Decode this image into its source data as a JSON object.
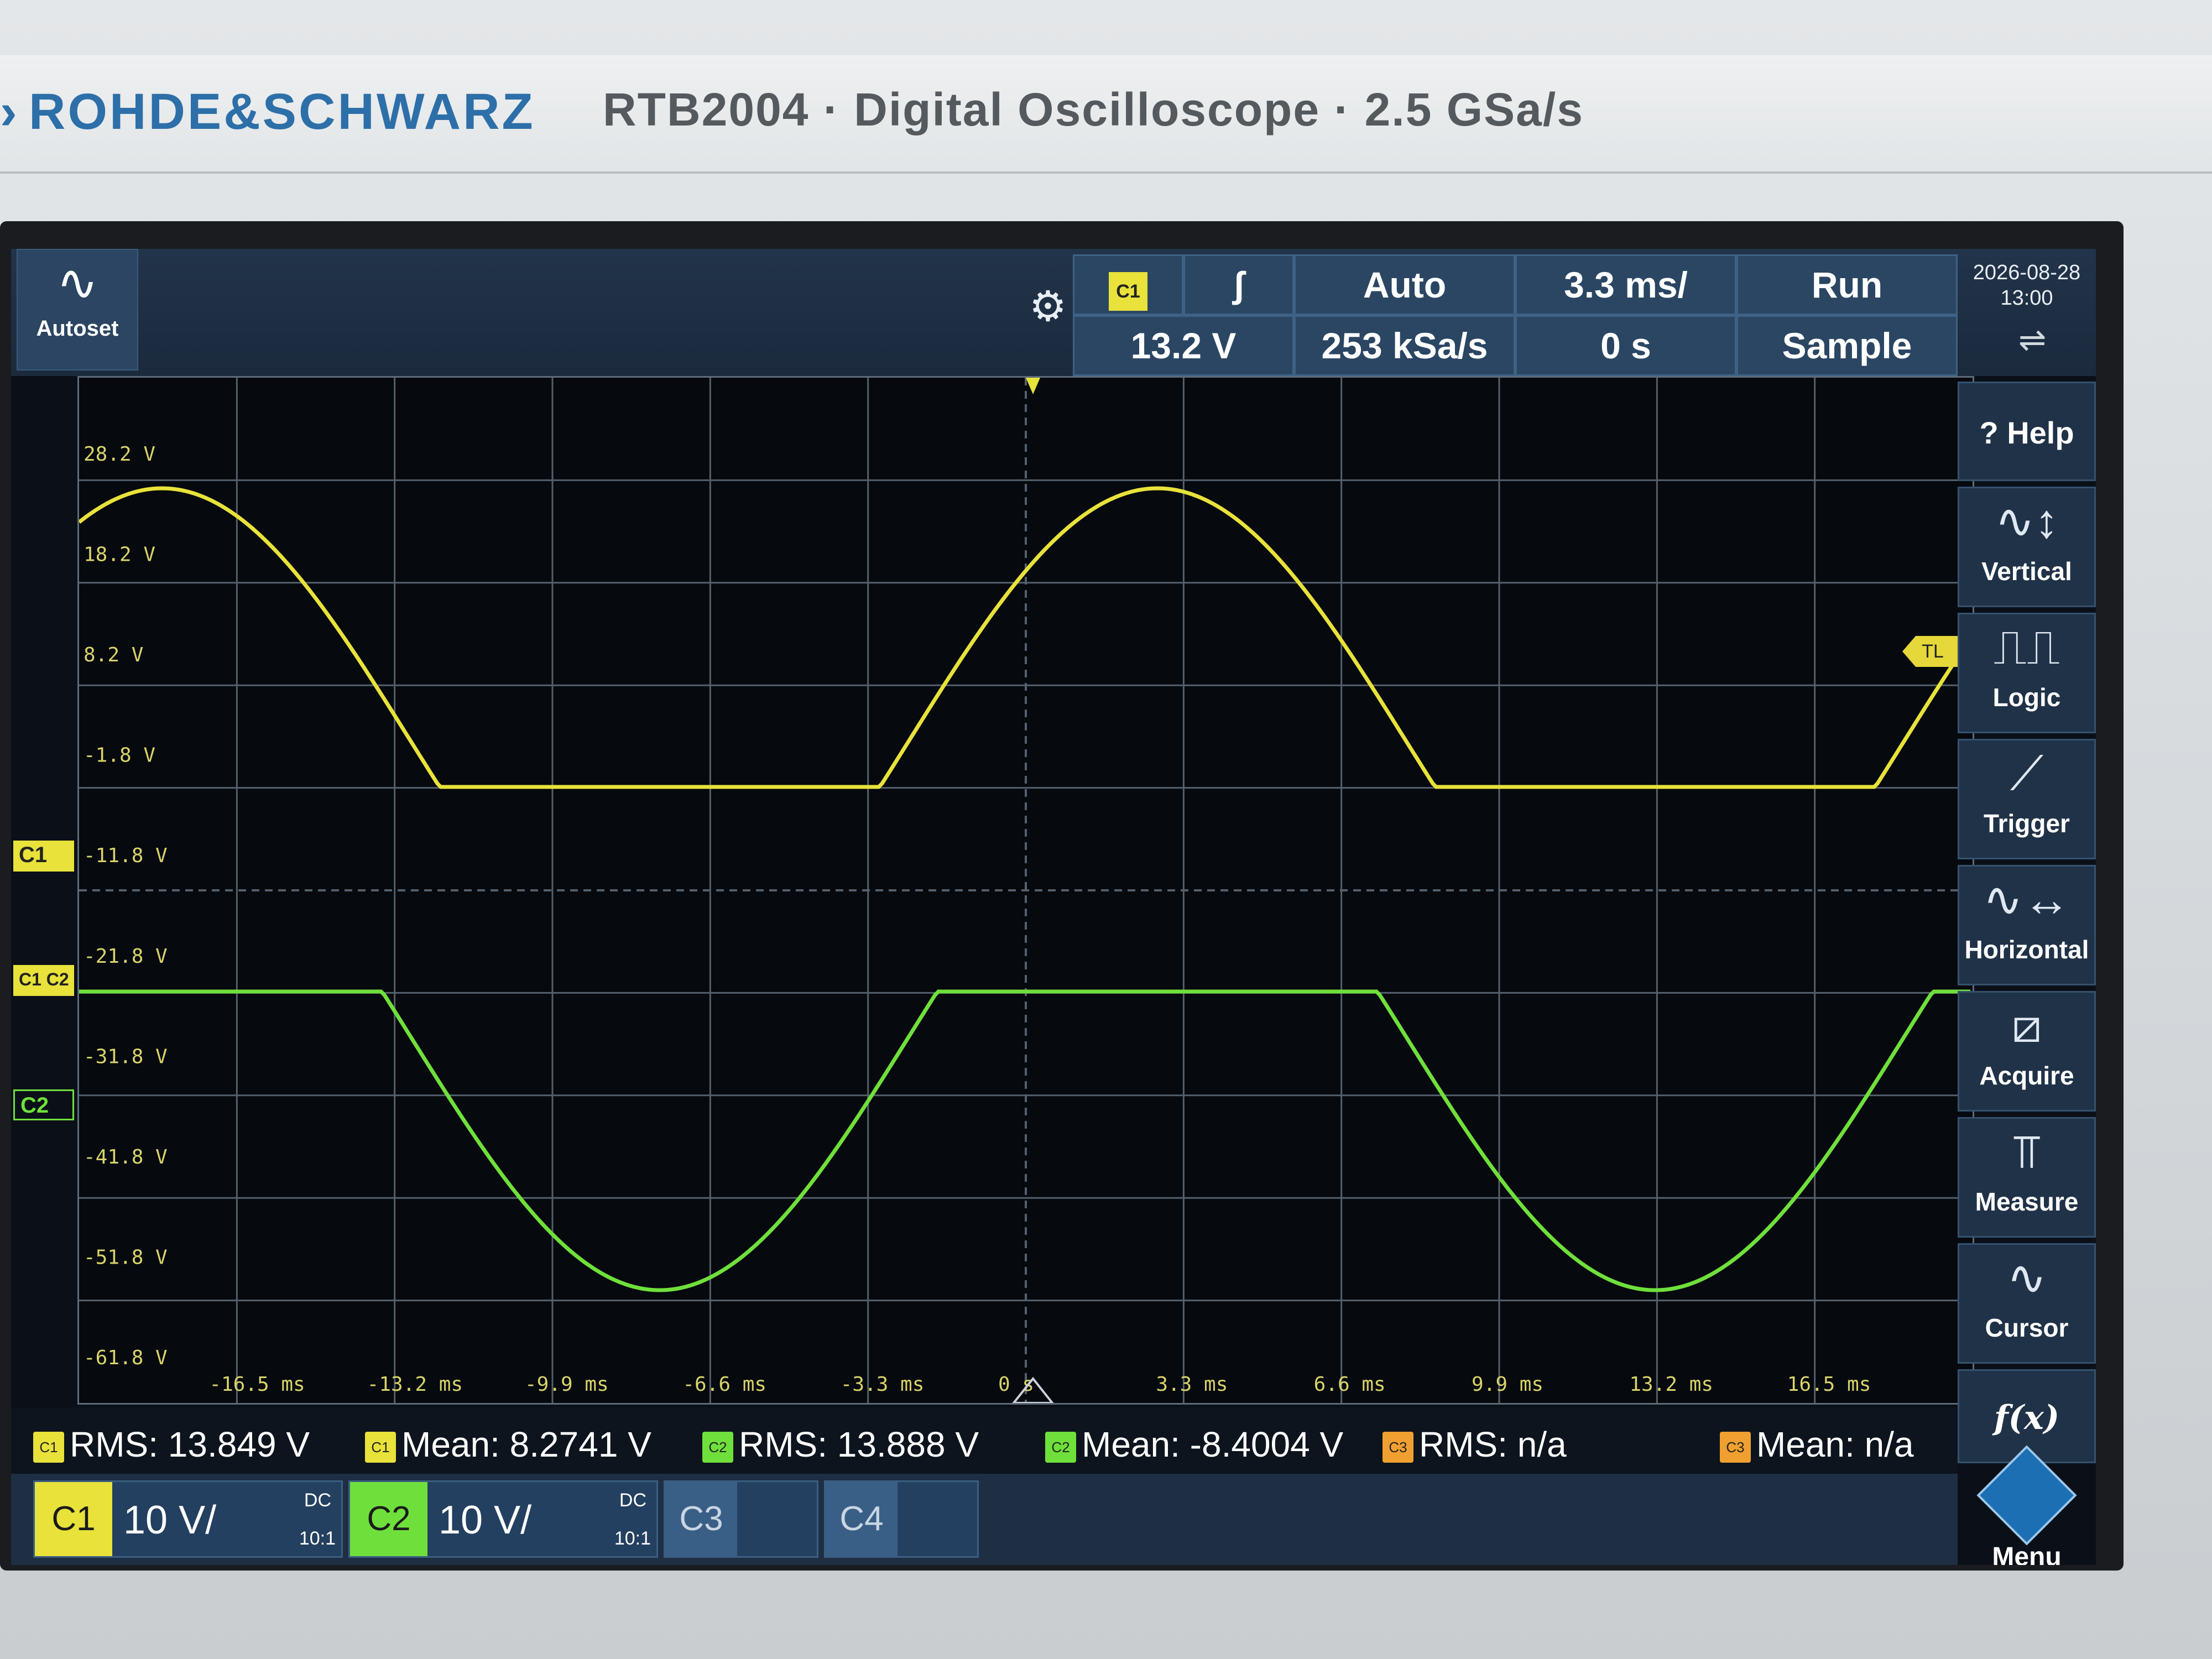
{
  "instrument": {
    "brand": "ROHDE&SCHWARZ",
    "model_line": "RTB2004 · Digital Oscilloscope · 2.5 GSa/s"
  },
  "toolbar": {
    "autoset_label": "Autoset",
    "trigger_source": "C1",
    "trigger_slope_icon": "rising-edge",
    "trigger_level": "13.2 V",
    "trigger_mode": "Auto",
    "sample_rate": "253 kSa/s",
    "time_scale": "3.3 ms/",
    "time_offset": "0 s",
    "run_state": "Run",
    "acq_mode": "Sample",
    "date": "2026-08-28",
    "time": "13:00"
  },
  "side_menu": [
    {
      "label": "Help",
      "icon": "help-icon"
    },
    {
      "label": "Vertical",
      "icon": "vertical-icon"
    },
    {
      "label": "Logic",
      "icon": "logic-icon"
    },
    {
      "label": "Trigger",
      "icon": "trigger-icon"
    },
    {
      "label": "Horizontal",
      "icon": "horizontal-icon"
    },
    {
      "label": "Acquire",
      "icon": "acquire-icon"
    },
    {
      "label": "Measure",
      "icon": "measure-icon"
    },
    {
      "label": "Cursor",
      "icon": "cursor-icon"
    },
    {
      "label": "f(x)",
      "icon": "math-icon"
    }
  ],
  "menu_label": "Menu",
  "grid": {
    "y_labels": [
      "28.2 V",
      "18.2 V",
      "8.2 V",
      "-1.8 V",
      "-11.8 V",
      "-21.8 V",
      "-31.8 V",
      "-41.8 V",
      "-51.8 V",
      "-61.8 V"
    ],
    "x_labels": [
      "-16.5 ms",
      "-13.2 ms",
      "-9.9 ms",
      "-6.6 ms",
      "-3.3 ms",
      "0 s",
      "3.3 ms",
      "6.6 ms",
      "9.9 ms",
      "13.2 ms",
      "16.5 ms"
    ],
    "tl_label": "TL"
  },
  "markers": {
    "c1": "C1",
    "c12": "C1 C2",
    "c2": "C2"
  },
  "colors": {
    "c1": "#e8e23a",
    "c2": "#6fe03b",
    "c3": "#f0a030",
    "grid": "#54606d",
    "label": "#d9d36a"
  },
  "measurements": [
    {
      "tag": "C1",
      "text": "RMS: 13.849 V"
    },
    {
      "tag": "C1",
      "text": "Mean: 8.2741 V"
    },
    {
      "tag": "C2",
      "text": "RMS: 13.888 V"
    },
    {
      "tag": "C2",
      "text": "Mean: -8.4004 V"
    },
    {
      "tag": "C3",
      "text": "RMS: n/a"
    },
    {
      "tag": "C3",
      "text": "Mean: n/a"
    }
  ],
  "channels": [
    {
      "id": "C1",
      "scale": "10 V/",
      "coupling": "DC",
      "probe": "10:1"
    },
    {
      "id": "C2",
      "scale": "10 V/",
      "coupling": "DC",
      "probe": "10:1"
    },
    {
      "id": "C3",
      "scale": "",
      "coupling": "",
      "probe": ""
    },
    {
      "id": "C4",
      "scale": "",
      "coupling": "",
      "probe": ""
    }
  ]
}
